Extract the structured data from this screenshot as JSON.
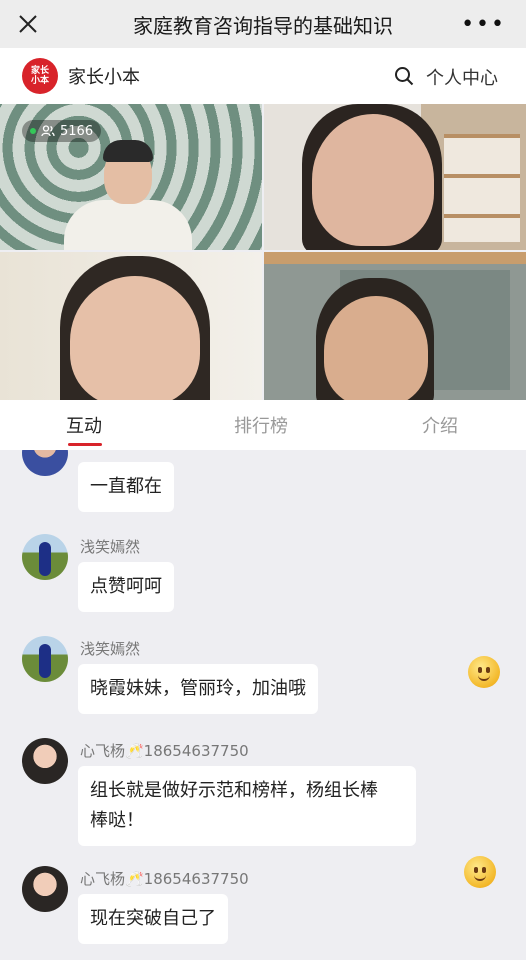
{
  "titlebar": {
    "title": "家庭教育咨询指导的基础知识",
    "more_label": "•••"
  },
  "appbar": {
    "logo_line1": "家长",
    "logo_line2": "小本",
    "brand": "家长小本",
    "personal_center": "个人中心"
  },
  "video": {
    "viewer_count": "5166"
  },
  "tabs": [
    {
      "label": "互动",
      "active": true
    },
    {
      "label": "排行榜"
    },
    {
      "label": "介绍"
    }
  ],
  "chat": [
    {
      "nick": "",
      "text": "一直都在"
    },
    {
      "nick": "浅笑嫣然",
      "text": "点赞呵呵"
    },
    {
      "nick": "浅笑嫣然",
      "text": "晓霞妹妹，管丽玲，加油哦"
    },
    {
      "nick": "心飞杨🥂18654637750",
      "text_line1": "组长就是做好示范和榜样，杨组长棒",
      "text_line2": "棒哒！"
    },
    {
      "nick": "心飞杨🥂18654637750",
      "text": "现在突破自己了"
    }
  ],
  "colors": {
    "brand_red": "#d8232a",
    "background": "#eeeef2"
  }
}
